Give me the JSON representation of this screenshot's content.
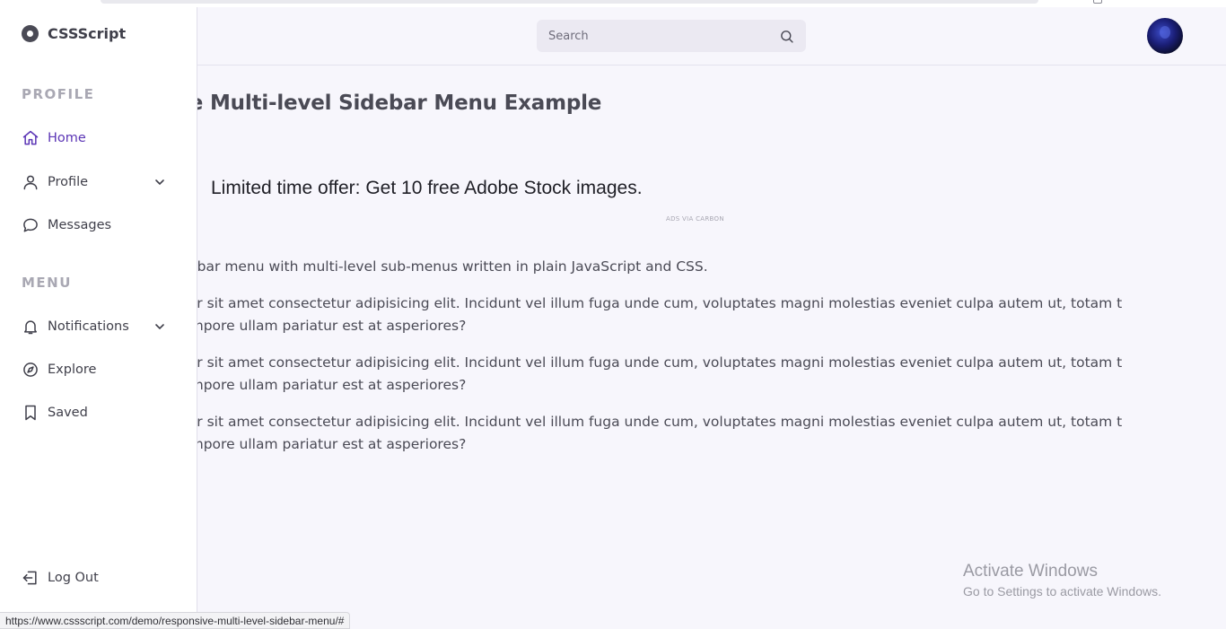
{
  "header": {
    "search_placeholder": "Search"
  },
  "main": {
    "title": "ve Multi-level Sidebar Menu Example",
    "ad": {
      "text": "Limited time offer: Get 10 free Adobe Stock images.",
      "credit": "ADS VIA CARBON"
    },
    "paragraphs": [
      "idebar menu with multi-level sub-menus written in plain JavaScript and CSS.",
      "olor sit amet consectetur adipisicing elit. Incidunt vel illum fuga unde cum, voluptates magni molestias eveniet culpa autem ut, totam t tempore ullam pariatur est at asperiores?",
      "olor sit amet consectetur adipisicing elit. Incidunt vel illum fuga unde cum, voluptates magni molestias eveniet culpa autem ut, totam t tempore ullam pariatur est at asperiores?",
      "olor sit amet consectetur adipisicing elit. Incidunt vel illum fuga unde cum, voluptates magni molestias eveniet culpa autem ut, totam t tempore ullam pariatur est at asperiores?"
    ]
  },
  "sidebar": {
    "brand": "CSSScript",
    "sections": {
      "profile": "PROFILE",
      "menu": "MENU"
    },
    "items": [
      {
        "label": "Home",
        "icon": "home-icon",
        "active": true
      },
      {
        "label": "Profile",
        "icon": "user-icon",
        "has_submenu": true
      },
      {
        "label": "Messages",
        "icon": "message-icon"
      },
      {
        "label": "Notifications",
        "icon": "bell-icon",
        "has_submenu": true
      },
      {
        "label": "Explore",
        "icon": "compass-icon"
      },
      {
        "label": "Saved",
        "icon": "bookmark-icon"
      }
    ],
    "logout": "Log Out"
  },
  "watermark": {
    "line1": "Activate Windows",
    "line2": "Go to Settings to activate Windows."
  },
  "status_url": "https://www.cssscript.com/demo/responsive-multi-level-sidebar-menu/#",
  "colors": {
    "accent": "#5b35b5",
    "background": "#f7f6fc",
    "sidebar": "#ffffff",
    "text": "#3a3a46",
    "section_label": "#a9a8b3"
  }
}
